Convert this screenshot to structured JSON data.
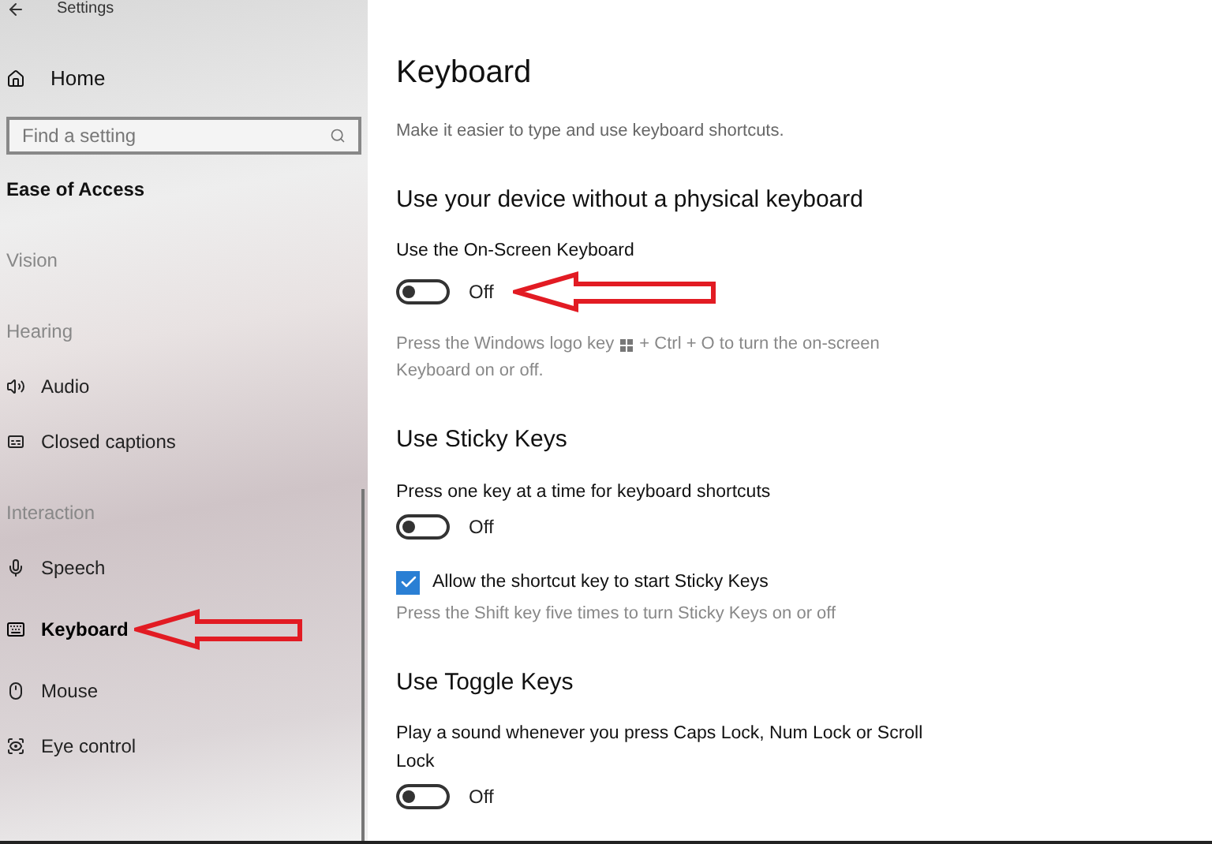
{
  "window": {
    "title": "Settings"
  },
  "sidebar": {
    "home": "Home",
    "search": {
      "placeholder": "Find a setting"
    },
    "category": "Ease of Access",
    "groups": [
      {
        "heading": "Vision"
      },
      {
        "heading": "Hearing",
        "items": [
          {
            "label": "Audio",
            "selected": false
          },
          {
            "label": "Closed captions",
            "selected": false
          }
        ]
      },
      {
        "heading": "Interaction",
        "items": [
          {
            "label": "Speech",
            "selected": false
          },
          {
            "label": "Keyboard",
            "selected": true
          },
          {
            "label": "Mouse",
            "selected": false
          },
          {
            "label": "Eye control",
            "selected": false
          }
        ]
      }
    ]
  },
  "page": {
    "title": "Keyboard",
    "subtitle": "Make it easier to type and use keyboard shortcuts.",
    "sections": [
      {
        "heading": "Use your device without a physical keyboard",
        "items": [
          {
            "kind": "toggle",
            "label": "Use the On-Screen Keyboard",
            "on": false,
            "state": "Off",
            "annotated": true
          },
          {
            "kind": "hint",
            "lines": [
              [
                "Press the Windows logo key",
                "+ Ctrl + O to turn the on-screen"
              ],
              [
                "Keyboard on or off."
              ]
            ]
          }
        ]
      },
      {
        "heading": "Use Sticky Keys",
        "items": [
          {
            "kind": "toggle",
            "label": "Press one key at a time for keyboard shortcuts",
            "on": false,
            "state": "Off",
            "annotated": false
          },
          {
            "kind": "checkbox",
            "label": "Allow the shortcut key to start Sticky Keys",
            "checked": true
          },
          {
            "kind": "hint",
            "lines": [
              [
                "Press the Shift key five times to turn Sticky Keys on or off"
              ]
            ]
          }
        ]
      },
      {
        "heading": "Use Toggle Keys",
        "items": [
          {
            "kind": "toggle",
            "label": "Play a sound whenever you press Caps Lock, Num Lock or Scroll Lock",
            "on": false,
            "state": "Off",
            "annotated": false
          }
        ]
      }
    ]
  }
}
